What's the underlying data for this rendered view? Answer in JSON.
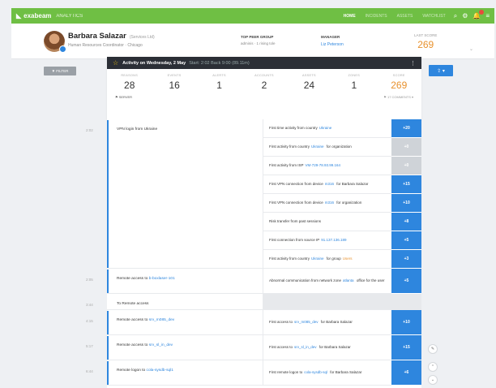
{
  "topbar": {
    "brand": "exabeam",
    "product": "ANALYTICS",
    "nav": [
      {
        "label": "HOME",
        "active": true
      },
      {
        "label": "INCIDENTS",
        "active": false
      },
      {
        "label": "ASSETS",
        "active": false
      },
      {
        "label": "WATCHLIST",
        "active": false
      }
    ]
  },
  "user": {
    "name": "Barbara Salazar",
    "name_note": "(Services Ltd)",
    "role": "Human Resources Coordinator",
    "location": "Chicago",
    "peer_group_label": "TOP PEER GROUP",
    "peer_group_value": "adminis · 1 rising tole",
    "manager_label": "MANAGER",
    "manager_value": "Liz Peterson",
    "last_score_label": "LAST SCORE",
    "last_score_value": "269"
  },
  "filter_label": "▼ FILTER",
  "share_label": "⇪ ▾",
  "activity": {
    "title": "Activity on Wednesday, 2 May",
    "subtitle": "Start: 2:02 Back 9:00 (89.11m)",
    "stats": [
      {
        "label": "REASONS",
        "value": "28"
      },
      {
        "label": "EVENTS",
        "value": "16"
      },
      {
        "label": "ALERTS",
        "value": "1"
      },
      {
        "label": "ACCOUNTS",
        "value": "2"
      },
      {
        "label": "ASSETS",
        "value": "24"
      },
      {
        "label": "ZONES",
        "value": "1"
      },
      {
        "label": "SCORE",
        "value": "269"
      }
    ],
    "foot_left": "⚑ SERVER",
    "foot_right": "⚑ 17 COMMENTS ▾"
  },
  "timeline": [
    {
      "time": "2:02",
      "event_text": "VPN login from Ukraine",
      "event_link": "",
      "grey": false,
      "reasons": [
        {
          "pre": "First time activity from country",
          "link": "Ukraine",
          "post": "",
          "score": "+20"
        },
        {
          "pre": "First activity from country",
          "link": "Ukraine",
          "post": "for organization",
          "score": "+0",
          "muted": true
        },
        {
          "pre": "First activity from ISP",
          "link": "VM-729-78.93.99.164",
          "post": "",
          "score": "+0",
          "muted": true
        },
        {
          "pre": "First VPN connection from device",
          "link": "m316",
          "post": "for Barbara Salazar",
          "score": "+15"
        },
        {
          "pre": "First VPN connection from device",
          "link": "m316",
          "post": "for organization",
          "score": "+10"
        },
        {
          "pre": "Risk transfer from past sessions",
          "link": "",
          "post": "",
          "score": "+8"
        },
        {
          "pre": "First connection from source IP",
          "link": "91.137.136.189",
          "post": "",
          "score": "+5"
        },
        {
          "pre": "First activity from country",
          "link": "Ukraine",
          "post": "for group",
          "org": "Users",
          "score": "+3"
        }
      ]
    },
    {
      "time": "2:05",
      "event_text": "Remote access to",
      "event_link": "b-boxlaser-101",
      "grey": false,
      "reasons": [
        {
          "pre": "Abnormal communication from network zone",
          "link": "atlanta",
          "post": "office for the user",
          "score": "+5"
        }
      ]
    },
    {
      "time": "3:44",
      "event_text": "To Remote access",
      "event_link": "",
      "grey": true,
      "reasons": []
    },
    {
      "time": "4:15",
      "event_text": "Remote access to",
      "event_link": "srv_m085_dev",
      "grey": false,
      "reasons": [
        {
          "pre": "First access to",
          "link": "srv_m085_dev",
          "post": "for Barbara Salazar",
          "score": "+10"
        }
      ]
    },
    {
      "time": "5:17",
      "event_text": "Remote access to",
      "event_link": "srv_sl_in_dev",
      "grey": false,
      "reasons": [
        {
          "pre": "First access to",
          "link": "srv_sl_in_dev",
          "post": "for Barbara Salazar",
          "score": "+15"
        }
      ]
    },
    {
      "time": "6:44",
      "event_text": "Remote logon to",
      "event_link": "cola-sysdb-sql1",
      "grey": false,
      "reasons": [
        {
          "pre": "First remote logon to",
          "link": "cola-sysdb-sql",
          "post": "for Barbara Salazar",
          "score": "+6"
        }
      ]
    }
  ]
}
